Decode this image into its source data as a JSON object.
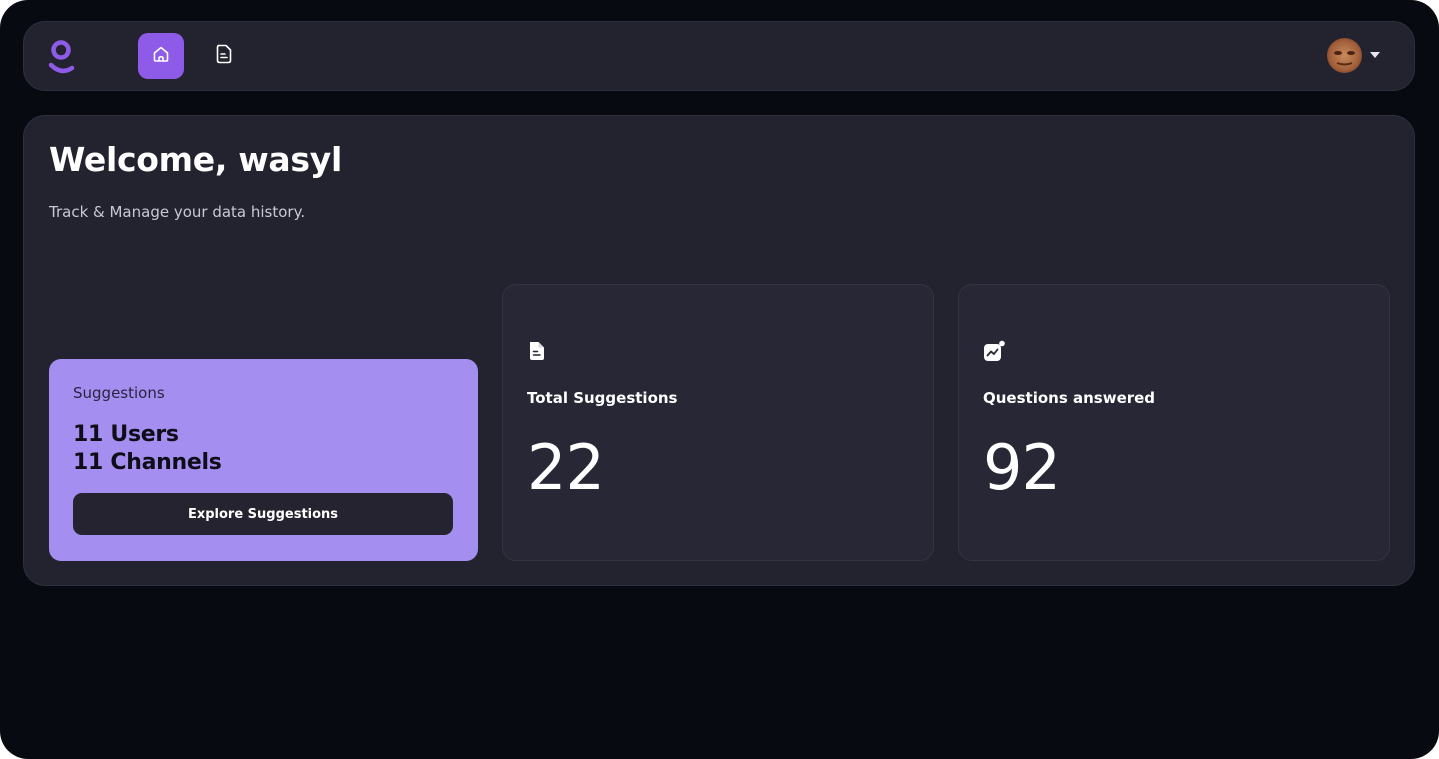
{
  "header": {
    "logo_icon": "person-logo-icon",
    "nav": [
      {
        "icon": "home-icon",
        "active": true
      },
      {
        "icon": "document-icon",
        "active": false
      }
    ],
    "user_menu": {
      "avatar": "user-avatar",
      "dropdown_icon": "caret-down-icon"
    }
  },
  "main": {
    "welcome": "Welcome, wasyl",
    "subtitle": "Track & Manage your data history."
  },
  "suggestions_card": {
    "label": "Suggestions",
    "users": "11 Users",
    "channels": "11 Channels",
    "button_label": "Explore Suggestions"
  },
  "stats": [
    {
      "icon": "document-icon",
      "label": "Total Suggestions",
      "value": "22"
    },
    {
      "icon": "chart-trend-icon",
      "label": "Questions answered",
      "value": "92"
    }
  ],
  "colors": {
    "accent": "#8d5be8",
    "card_highlight": "#a48ff0",
    "background": "#080a11",
    "surface": "#23232f"
  }
}
